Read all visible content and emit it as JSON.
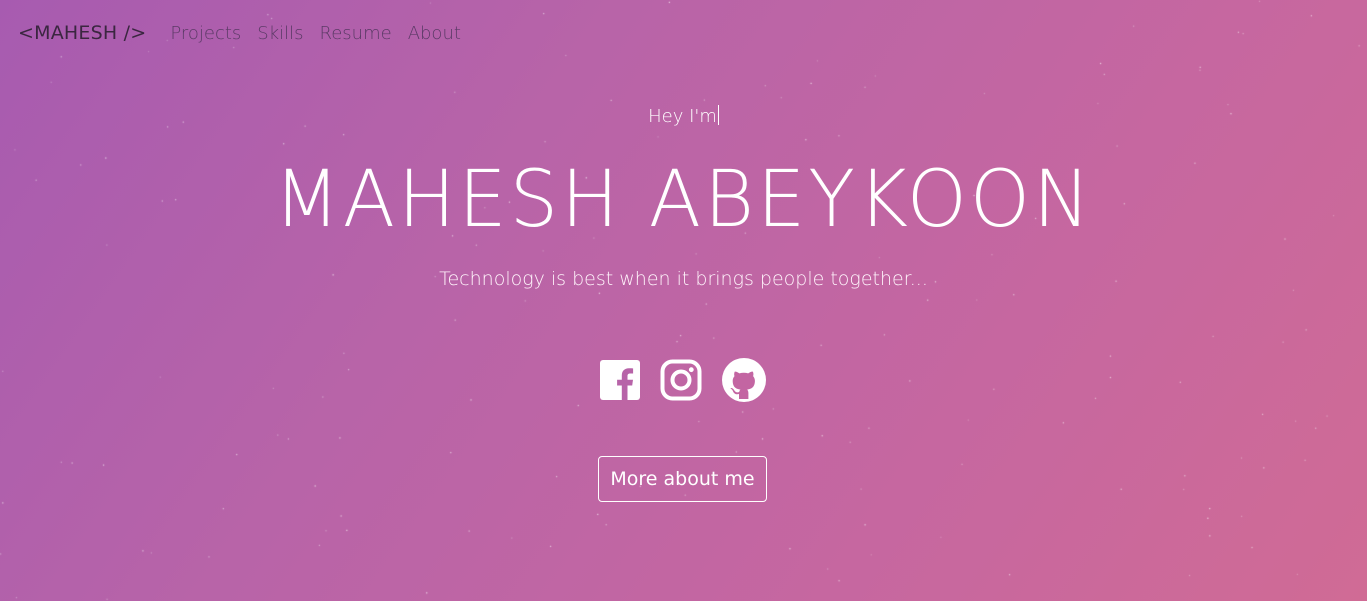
{
  "navbar": {
    "brand": "<MAHESH />",
    "links": [
      "Projects",
      "Skills",
      "Resume",
      "About"
    ]
  },
  "hero": {
    "greeting": "Hey I'm",
    "name": "MAHESH ABEYKOON",
    "tagline": "Technology is best when it brings people together..."
  },
  "socials": [
    {
      "icon": "facebook-icon"
    },
    {
      "icon": "instagram-icon"
    },
    {
      "icon": "github-icon"
    }
  ],
  "cta": {
    "label": "More about me"
  },
  "colors": {
    "gradient_start": "#a75bb0",
    "gradient_end": "#d06b95",
    "nav_text": "#5b3a66",
    "brand_text": "#3a2640",
    "hero_text": "#ffffff"
  }
}
